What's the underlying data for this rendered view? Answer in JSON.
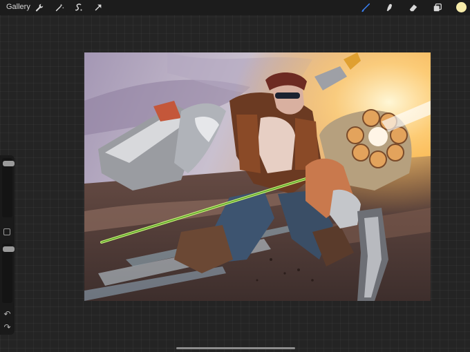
{
  "topbar": {
    "gallery_label": "Gallery",
    "left_tools": [
      "wrench-icon",
      "magic-wand-icon",
      "selection-icon",
      "transform-arrow-icon"
    ],
    "right_tools": [
      "brush-icon",
      "smudge-icon",
      "eraser-icon",
      "layers-icon"
    ],
    "active_tool": "brush-icon",
    "accent_color": "#3b82f6",
    "current_color": "#f7ecaa"
  },
  "sidebar": {
    "brush_size_level": 0.95,
    "opacity_level": 0.95,
    "undo_icon": "undo-arrow-icon",
    "redo_icon": "redo-arrow-icon"
  },
  "canvas": {
    "content": "illustration"
  }
}
